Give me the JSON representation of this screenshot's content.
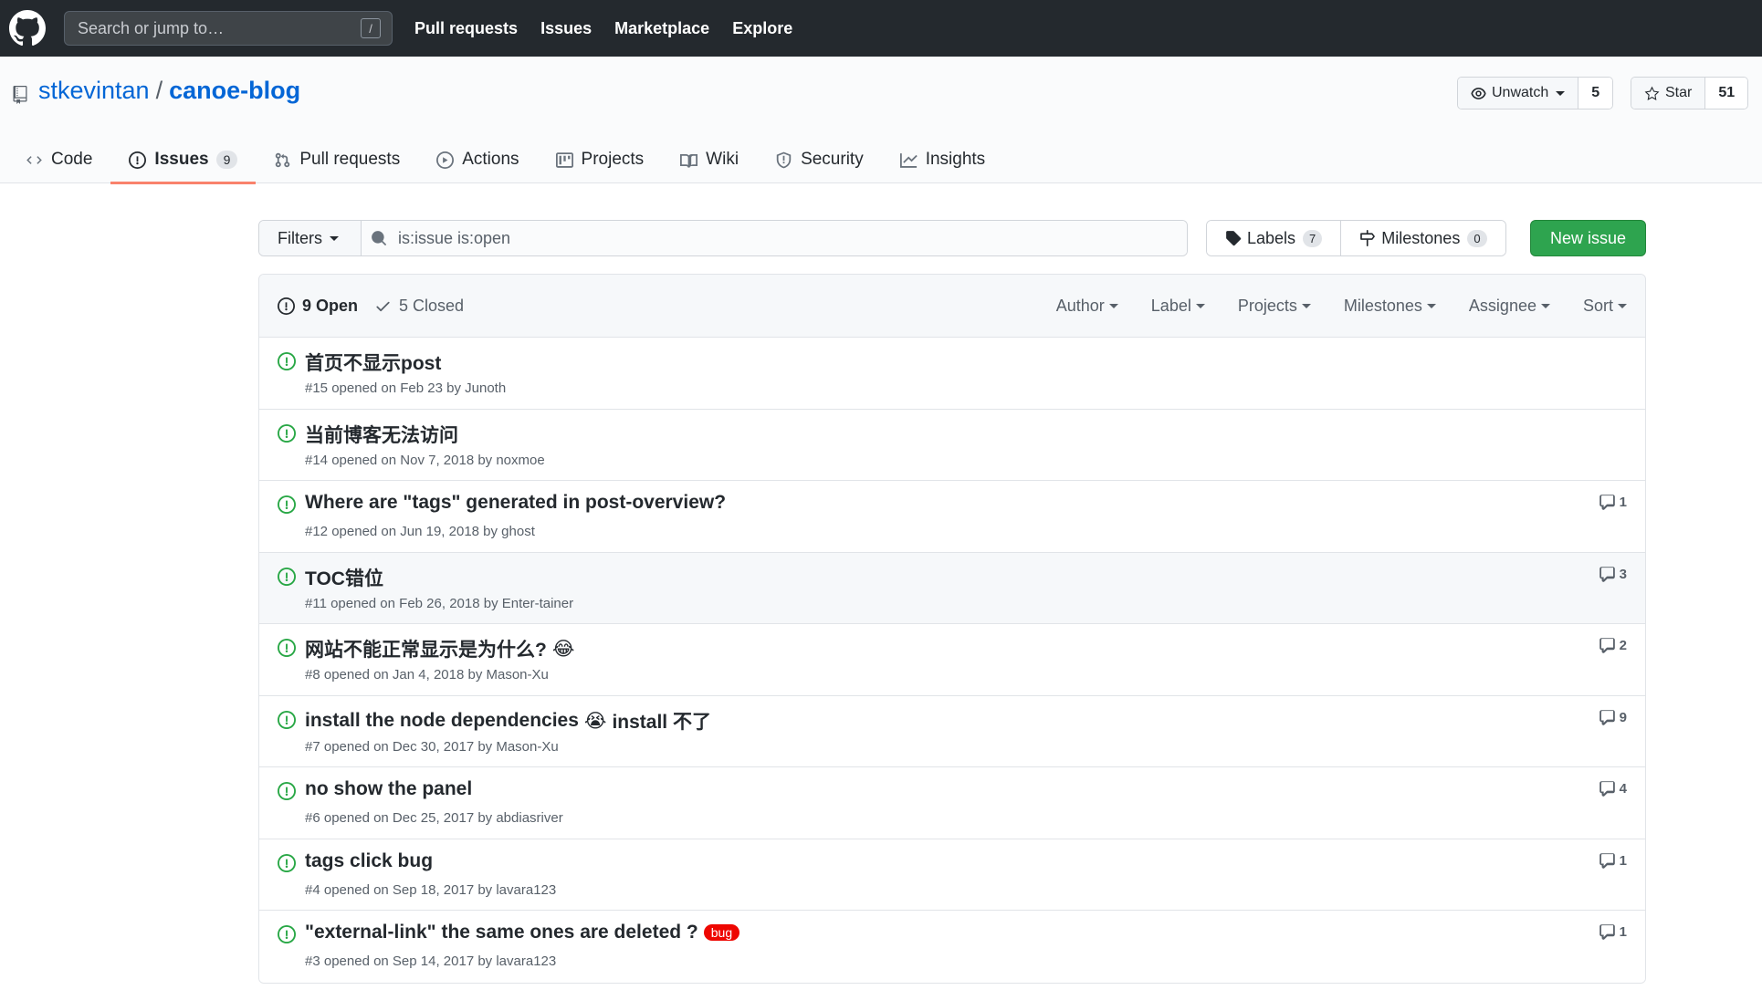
{
  "header": {
    "search_placeholder": "Search or jump to…",
    "slash_key": "/",
    "nav": [
      "Pull requests",
      "Issues",
      "Marketplace",
      "Explore"
    ]
  },
  "repo": {
    "owner": "stkevintan",
    "separator": "/",
    "name": "canoe-blog",
    "unwatch_label": "Unwatch",
    "watch_count": "5",
    "star_label": "Star",
    "star_count": "51"
  },
  "tabs": [
    {
      "label": "Code",
      "icon": "code-icon"
    },
    {
      "label": "Issues",
      "icon": "issue-opened-icon",
      "counter": "9",
      "selected": true
    },
    {
      "label": "Pull requests",
      "icon": "git-pull-request-icon"
    },
    {
      "label": "Actions",
      "icon": "play-icon"
    },
    {
      "label": "Projects",
      "icon": "project-icon"
    },
    {
      "label": "Wiki",
      "icon": "book-icon"
    },
    {
      "label": "Security",
      "icon": "shield-icon"
    },
    {
      "label": "Insights",
      "icon": "graph-icon"
    }
  ],
  "subnav": {
    "filters_label": "Filters",
    "search_value": "is:issue is:open",
    "labels_label": "Labels",
    "labels_count": "7",
    "milestones_label": "Milestones",
    "milestones_count": "0",
    "new_issue_label": "New issue"
  },
  "issues_header": {
    "open_label": "9 Open",
    "closed_label": "5 Closed",
    "sorters": [
      "Author",
      "Label",
      "Projects",
      "Milestones",
      "Assignee",
      "Sort"
    ]
  },
  "issues": [
    {
      "title": "首页不显示post",
      "meta": "#15 opened on Feb 23 by Junoth",
      "comments": "",
      "emoji": "",
      "suffix": "",
      "label": ""
    },
    {
      "title": "当前博客无法访问",
      "meta": "#14 opened on Nov 7, 2018 by noxmoe",
      "comments": "",
      "emoji": "",
      "suffix": "",
      "label": ""
    },
    {
      "title": "Where are \"tags\" generated in post-overview?",
      "meta": "#12 opened on Jun 19, 2018 by ghost",
      "comments": "1",
      "emoji": "",
      "suffix": "",
      "label": ""
    },
    {
      "title": "TOC错位",
      "meta": "#11 opened on Feb 26, 2018 by Enter-tainer",
      "comments": "3",
      "emoji": "",
      "suffix": "",
      "label": ""
    },
    {
      "title": "网站不能正常显示是为什么?",
      "meta": "#8 opened on Jan 4, 2018 by Mason-Xu",
      "comments": "2",
      "emoji": "😂",
      "suffix": "",
      "label": ""
    },
    {
      "title": "install the node dependencies",
      "meta": "#7 opened on Dec 30, 2017 by Mason-Xu",
      "comments": "9",
      "emoji": "😭",
      "suffix": "install 不了",
      "label": ""
    },
    {
      "title": "no show the panel",
      "meta": "#6 opened on Dec 25, 2017 by abdiasriver",
      "comments": "4",
      "emoji": "",
      "suffix": "",
      "label": ""
    },
    {
      "title": "tags click bug",
      "meta": "#4 opened on Sep 18, 2017 by lavara123",
      "comments": "1",
      "emoji": "",
      "suffix": "",
      "label": ""
    },
    {
      "title": "\"external-link\" the same ones are deleted ?",
      "meta": "#3 opened on Sep 14, 2017 by lavara123",
      "comments": "1",
      "emoji": "",
      "suffix": "",
      "label": "bug"
    }
  ],
  "colors": {
    "header_bg": "#24292e",
    "link": "#0366d6",
    "open_green": "#28a745",
    "new_issue_green": "#2ea44f",
    "tab_underline": "#f9826c",
    "bug_label": "#ee0701"
  }
}
